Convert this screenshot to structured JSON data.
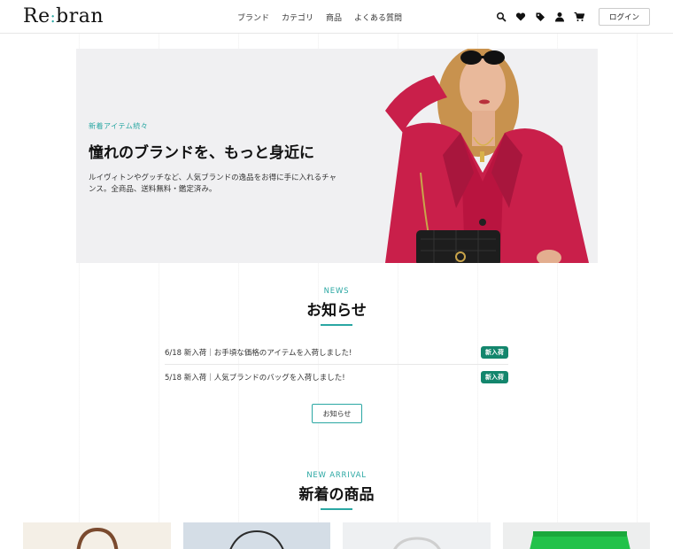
{
  "header": {
    "logo": {
      "left": "Re",
      "right": "bran"
    },
    "nav": [
      "ブランド",
      "カテゴリ",
      "商品",
      "よくある質問"
    ],
    "icons": [
      "search-icon",
      "heart-icon",
      "tag-icon",
      "user-icon",
      "cart-icon"
    ],
    "login_label": "ログイン"
  },
  "hero": {
    "kicker": "新着アイテム続々",
    "title": "憧れのブランドを、もっと身近に",
    "description": "ルイヴィトンやグッチなど、人気ブランドの逸品をお得に手に入れるチャンス。全商品、送料無料・鑑定済み。"
  },
  "news": {
    "kicker": "NEWS",
    "title": "お知らせ",
    "items": [
      {
        "text": "6/18 新入荷｜お手頃な価格のアイテムを入荷しました!",
        "badge": "新入荷"
      },
      {
        "text": "5/18 新入荷｜人気ブランドのバッグを入荷しました!",
        "badge": "新入荷"
      }
    ],
    "more_label": "お知らせ"
  },
  "new_arrival": {
    "kicker": "NEW ARRIVAL",
    "title": "新着の商品"
  },
  "colors": {
    "accent": "#2aa7a3",
    "badge": "#13866d",
    "hero_bg": "#f0f0f2"
  }
}
